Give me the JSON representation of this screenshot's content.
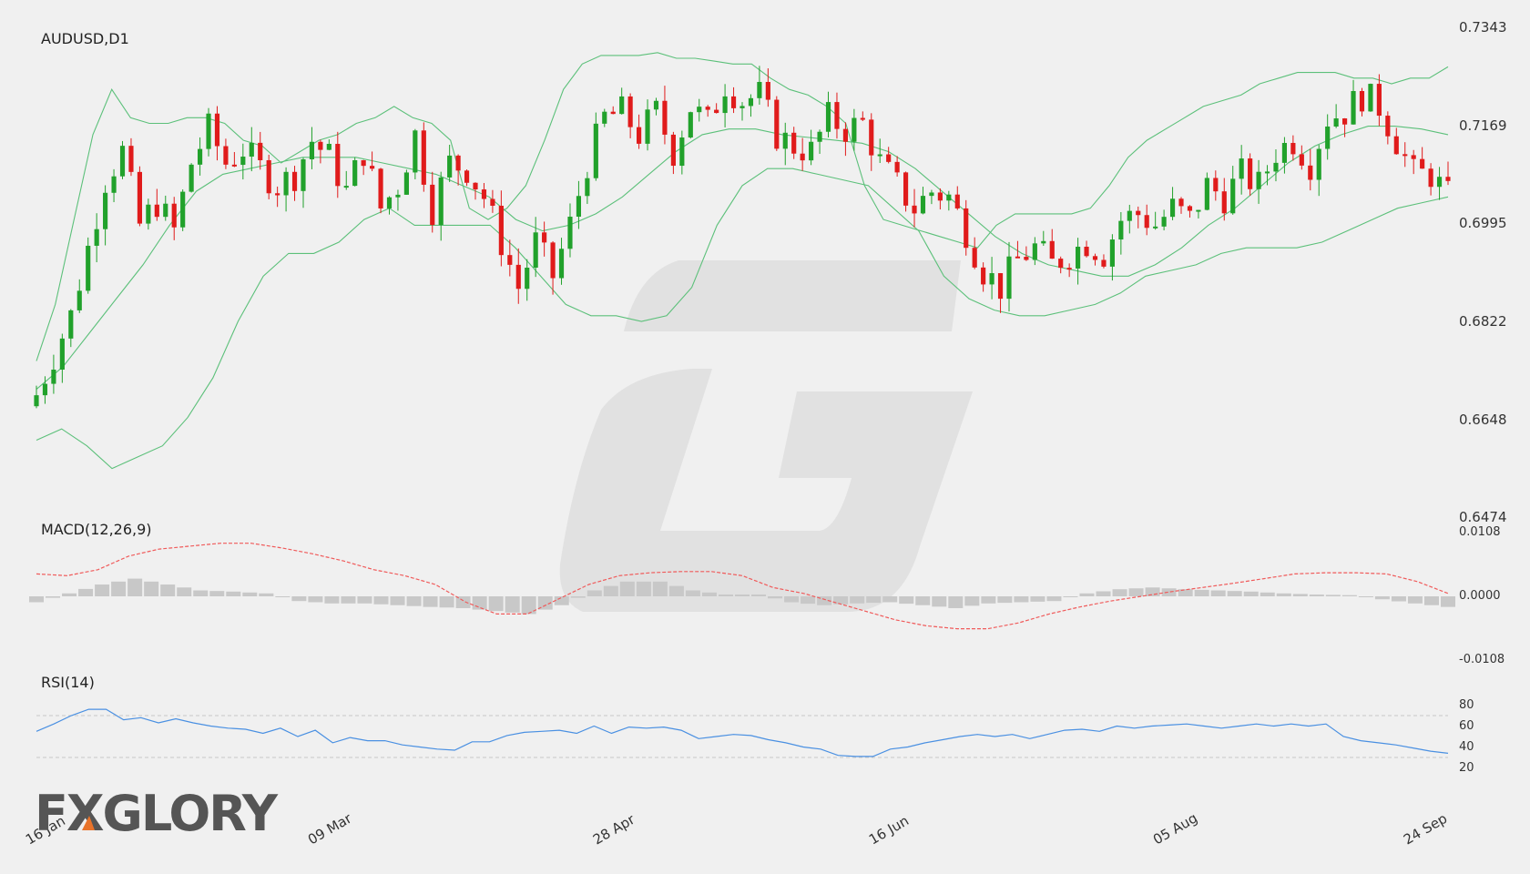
{
  "brand": {
    "logo_text": "FXGLORY",
    "accent": "#e8732a",
    "logo_color": "#555555"
  },
  "colors": {
    "bull": "#21a12b",
    "bear": "#e01b1b",
    "band": "#5cc07a",
    "macd_signal": "#f05a5a",
    "macd_hist": "#c8c8c8",
    "rsi": "#4a90e2"
  },
  "chart_data": [
    {
      "panel": "price",
      "type": "candlestick",
      "title": "AUDUSD,D1",
      "yticks": [
        "0.7343",
        "0.7169",
        "0.6995",
        "0.6822",
        "0.6648",
        "0.6474"
      ],
      "ylim": [
        0.6474,
        0.7343
      ],
      "x_ticks": [
        "16 Jan",
        "09 Mar",
        "28 Apr",
        "16 Jun",
        "05 Aug",
        "24 Sep"
      ],
      "close_path": [
        0.669,
        0.676,
        0.683,
        0.695,
        0.707,
        0.712,
        0.699,
        0.703,
        0.698,
        0.71,
        0.716,
        0.71,
        0.7125,
        0.709,
        0.706,
        0.708,
        0.714,
        0.711,
        0.705,
        0.712,
        0.702,
        0.706,
        0.715,
        0.702,
        0.71,
        0.709,
        0.704,
        0.696,
        0.688,
        0.696,
        0.69,
        0.699,
        0.71,
        0.718,
        0.719,
        0.715,
        0.719,
        0.712,
        0.72,
        0.717,
        0.724,
        0.721,
        0.722,
        0.715,
        0.713,
        0.712,
        0.718,
        0.716,
        0.717,
        0.71,
        0.706,
        0.702,
        0.705,
        0.704,
        0.698,
        0.691,
        0.688,
        0.693,
        0.695,
        0.692,
        0.694,
        0.696,
        0.694,
        0.7,
        0.701,
        0.699,
        0.702,
        0.7,
        0.706,
        0.704,
        0.708,
        0.706,
        0.712,
        0.714,
        0.71,
        0.718,
        0.719,
        0.722,
        0.72,
        0.714,
        0.708,
        0.708,
        0.704
      ],
      "upper_band": [
        0.675,
        0.685,
        0.7,
        0.715,
        0.723,
        0.718,
        0.717,
        0.717,
        0.718,
        0.718,
        0.717,
        0.714,
        0.713,
        0.71,
        0.712,
        0.714,
        0.715,
        0.717,
        0.718,
        0.72,
        0.718,
        0.717,
        0.714,
        0.702,
        0.7,
        0.702,
        0.706,
        0.714,
        0.723,
        0.7275,
        0.729,
        0.729,
        0.729,
        0.7295,
        0.7285,
        0.7285,
        0.728,
        0.7275,
        0.7275,
        0.725,
        0.723,
        0.722,
        0.72,
        0.717,
        0.706,
        0.7,
        0.699,
        0.698,
        0.697,
        0.696,
        0.695,
        0.699,
        0.701,
        0.701,
        0.701,
        0.701,
        0.702,
        0.706,
        0.711,
        0.714,
        0.716,
        0.718,
        0.72,
        0.721,
        0.722,
        0.724,
        0.725,
        0.726,
        0.726,
        0.726,
        0.725,
        0.725,
        0.724,
        0.725,
        0.725,
        0.727
      ],
      "middle_band": [
        0.67,
        0.674,
        0.68,
        0.686,
        0.692,
        0.699,
        0.705,
        0.708,
        0.709,
        0.71,
        0.711,
        0.711,
        0.711,
        0.71,
        0.709,
        0.708,
        0.706,
        0.704,
        0.7,
        0.698,
        0.699,
        0.701,
        0.704,
        0.708,
        0.712,
        0.715,
        0.716,
        0.716,
        0.715,
        0.7145,
        0.714,
        0.7135,
        0.712,
        0.709,
        0.705,
        0.701,
        0.697,
        0.694,
        0.692,
        0.691,
        0.69,
        0.69,
        0.692,
        0.695,
        0.699,
        0.702,
        0.706,
        0.71,
        0.713,
        0.715,
        0.7165,
        0.7165,
        0.716,
        0.715
      ],
      "lower_band": [
        0.661,
        0.663,
        0.66,
        0.656,
        0.658,
        0.66,
        0.665,
        0.672,
        0.682,
        0.69,
        0.694,
        0.694,
        0.696,
        0.7,
        0.702,
        0.699,
        0.699,
        0.699,
        0.699,
        0.695,
        0.69,
        0.685,
        0.683,
        0.683,
        0.682,
        0.683,
        0.688,
        0.699,
        0.706,
        0.709,
        0.709,
        0.708,
        0.707,
        0.706,
        0.702,
        0.698,
        0.69,
        0.686,
        0.684,
        0.683,
        0.683,
        0.684,
        0.685,
        0.687,
        0.69,
        0.691,
        0.692,
        0.694,
        0.695,
        0.695,
        0.695,
        0.696,
        0.698,
        0.7,
        0.702,
        0.703,
        0.704
      ]
    },
    {
      "panel": "macd",
      "type": "histogram+line",
      "title": "MACD(12,26,9)",
      "yticks": [
        "0.0108",
        "0.0000",
        "-0.0108"
      ],
      "ylim": [
        -0.0108,
        0.0108
      ],
      "signal": [
        0.0038,
        0.0035,
        0.0045,
        0.0068,
        0.008,
        0.0085,
        0.009,
        0.009,
        0.0082,
        0.0072,
        0.006,
        0.0045,
        0.0035,
        0.002,
        -0.001,
        -0.003,
        -0.003,
        -0.0005,
        0.002,
        0.0035,
        0.004,
        0.0042,
        0.0042,
        0.0035,
        0.0015,
        0.0005,
        -0.001,
        -0.0025,
        -0.004,
        -0.005,
        -0.0055,
        -0.0055,
        -0.0045,
        -0.003,
        -0.0018,
        -0.0008,
        0.0,
        0.0008,
        0.0015,
        0.0022,
        0.003,
        0.0038,
        0.004,
        0.004,
        0.0038,
        0.0025,
        0.0005
      ],
      "histogram": [
        -0.001,
        0.0005,
        0.002,
        0.003,
        0.002,
        0.001,
        0.0008,
        0.0005,
        -0.0008,
        -0.0012,
        -0.0012,
        -0.0015,
        -0.0018,
        -0.002,
        -0.0025,
        -0.003,
        -0.0015,
        0.001,
        0.0025,
        0.0025,
        0.001,
        0.0003,
        0.0003,
        -0.001,
        -0.0015,
        -0.0012,
        -0.001,
        -0.0015,
        -0.002,
        -0.0012,
        -0.001,
        -0.0008,
        0.0005,
        0.0012,
        0.0015,
        0.0012,
        0.001,
        0.0008,
        0.0005,
        0.0003,
        0.0002,
        -0.0005,
        -0.0012,
        -0.0018
      ]
    },
    {
      "panel": "rsi",
      "type": "line",
      "title": "RSI(14)",
      "yticks": [
        "80",
        "60",
        "40",
        "20"
      ],
      "ylim": [
        20,
        80
      ],
      "levels": [
        70,
        30
      ],
      "values": [
        55,
        62,
        70,
        76,
        76,
        66,
        68,
        63,
        67,
        63,
        60,
        58,
        57,
        53,
        58,
        50,
        56,
        44,
        49,
        46,
        46,
        42,
        40,
        38,
        37,
        45,
        45,
        51,
        54,
        55,
        56,
        53,
        60,
        53,
        59,
        58,
        59,
        56,
        48,
        50,
        52,
        51,
        47,
        44,
        40,
        38,
        32,
        31,
        31,
        38,
        40,
        44,
        47,
        50,
        52,
        50,
        52,
        48,
        52,
        56,
        57,
        55,
        60,
        58,
        60,
        61,
        62,
        60,
        58,
        60,
        62,
        60,
        62,
        60,
        62,
        50,
        46,
        44,
        42,
        39,
        36,
        34
      ]
    }
  ]
}
